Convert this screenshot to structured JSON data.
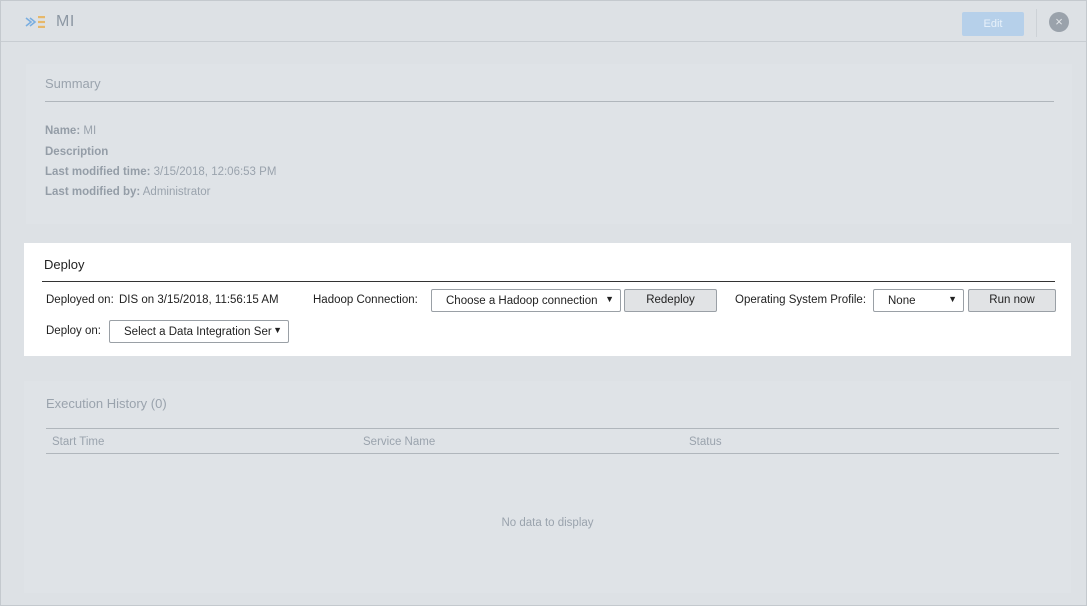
{
  "window": {
    "title": "MI",
    "edit_label": "Edit",
    "close_glyph": "×"
  },
  "summary": {
    "title": "Summary",
    "fields": [
      {
        "label": "Name:",
        "value": "MI"
      },
      {
        "label": "Description",
        "value": ""
      },
      {
        "label": "Last modified time:",
        "value": "3/15/2018, 12:06:53 PM"
      },
      {
        "label": "Last modified by:",
        "value": "Administrator"
      }
    ]
  },
  "deploy": {
    "title": "Deploy",
    "deployed_on_label": "Deployed on:",
    "deployed_on_value": "DIS on 3/15/2018, 11:56:15 AM",
    "hadoop_label": "Hadoop Connection:",
    "hadoop_select": "Choose a Hadoop connection",
    "redeploy_label": "Redeploy",
    "os_profile_label": "Operating System Profile:",
    "os_profile_select": "None",
    "run_now_label": "Run now",
    "deploy_on_label": "Deploy on:",
    "deploy_on_select": "Select a Data Integration Ser"
  },
  "history": {
    "title": "Execution History (0)",
    "columns": [
      "Start Time",
      "Service Name",
      "Status"
    ],
    "empty_text": "No data to display"
  },
  "colors": {
    "dim_background": "#dde1e5",
    "active_panel": "#ffffff",
    "edit_button": "#b6d0ea",
    "muted_text": "#9aa3ad"
  },
  "icons": {
    "app": "mapping-icon",
    "close": "close-icon",
    "dropdown": "triangle-down-icon"
  }
}
